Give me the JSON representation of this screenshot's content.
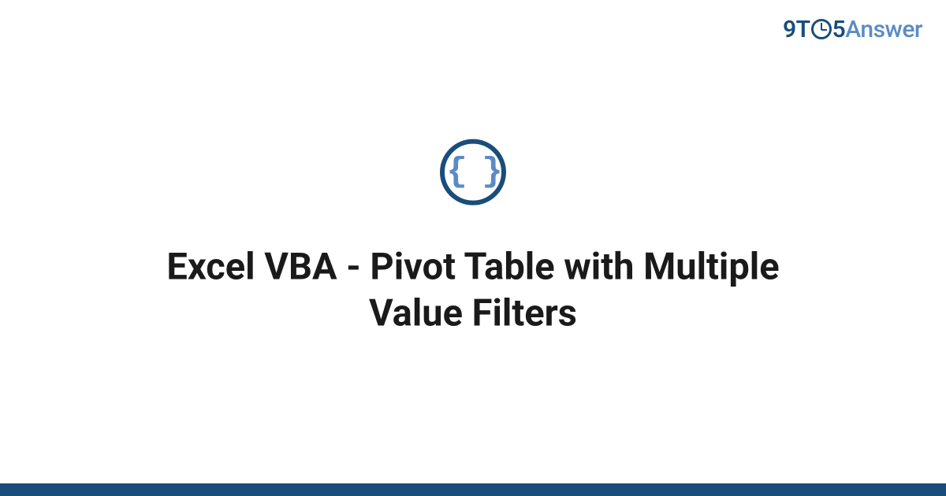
{
  "brand": {
    "part1": "9T",
    "part2": "5",
    "part3": "Answer"
  },
  "icon": {
    "braces": "{ }"
  },
  "title": "Excel VBA - Pivot Table with Multiple Value Filters",
  "colors": {
    "primary": "#1a4d7a",
    "secondary": "#5b8bc4"
  }
}
